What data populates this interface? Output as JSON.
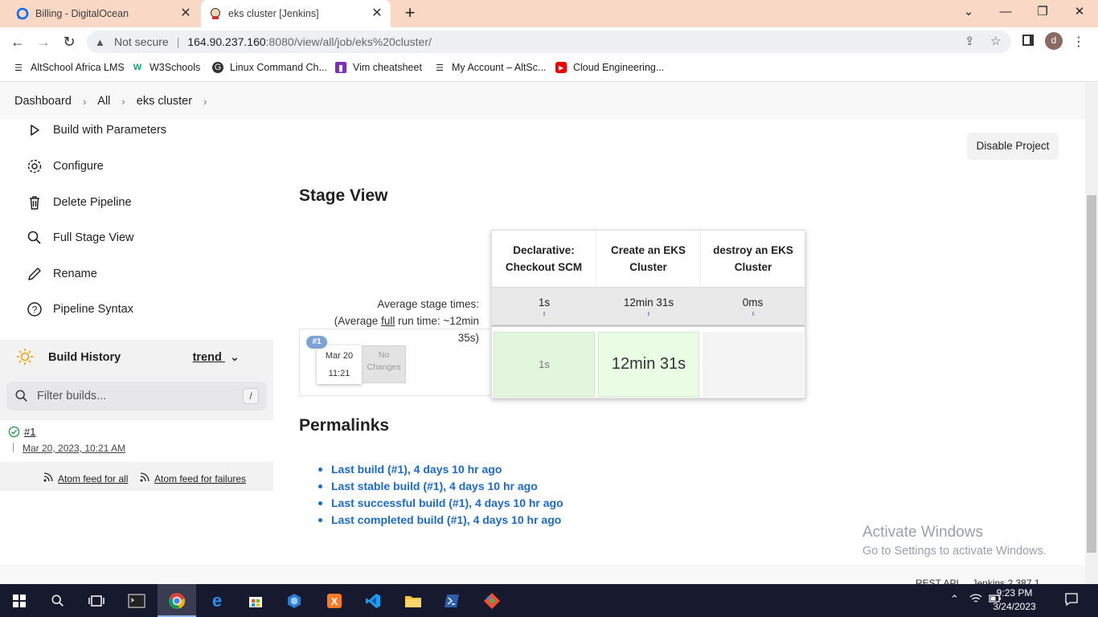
{
  "browser": {
    "tabs": [
      {
        "title": "Billing - DigitalOcean",
        "icon": "digitalocean-icon"
      },
      {
        "title": "eks cluster [Jenkins]",
        "icon": "jenkins-icon",
        "active": true
      }
    ],
    "address": {
      "security": "Not secure",
      "host": "164.90.237.160",
      "path": ":8080/view/all/job/eks%20cluster/"
    },
    "profile_initial": "d",
    "bookmarks": [
      {
        "label": "AltSchool Africa LMS",
        "icon": "folder-icon"
      },
      {
        "label": "W3Schools",
        "icon": "w3schools-icon"
      },
      {
        "label": "Linux Command Ch...",
        "icon": "linux-icon"
      },
      {
        "label": "Vim cheatsheet",
        "icon": "vim-icon"
      },
      {
        "label": "My Account – AltSc...",
        "icon": "folder-icon"
      },
      {
        "label": "Cloud Engineering...",
        "icon": "youtube-icon"
      }
    ]
  },
  "breadcrumb": [
    "Dashboard",
    "All",
    "eks cluster"
  ],
  "sidebar": {
    "tasks": [
      {
        "label": "Build with Parameters",
        "icon": "play-icon"
      },
      {
        "label": "Configure",
        "icon": "gear-icon"
      },
      {
        "label": "Delete Pipeline",
        "icon": "trash-icon"
      },
      {
        "label": "Full Stage View",
        "icon": "search-icon"
      },
      {
        "label": "Rename",
        "icon": "pencil-icon"
      },
      {
        "label": "Pipeline Syntax",
        "icon": "help-icon"
      }
    ],
    "build_history": {
      "title": "Build History",
      "trend": "trend",
      "filter_placeholder": "Filter builds...",
      "shortcut": "/",
      "builds": [
        {
          "number": "#1",
          "date": "Mar 20, 2023, 10:21 AM",
          "status": "success"
        }
      ],
      "feeds": [
        "Atom feed for all",
        "Atom feed for failures"
      ]
    }
  },
  "main": {
    "disable_button": "Disable Project",
    "stage_view_title": "Stage View",
    "avg_label": "Average stage times:",
    "avg_full_1": "(Average ",
    "avg_full_word": "full",
    "avg_full_2": " run time: ~12min",
    "avg_full_3": "35s)",
    "run": {
      "badge": "#1",
      "date": "Mar 20",
      "time": "11:21",
      "changes_1": "No",
      "changes_2": "Changes"
    },
    "stages": [
      {
        "name": "Declarative: Checkout SCM",
        "avg": "1s",
        "value": "1s",
        "status": "success"
      },
      {
        "name": "Create an EKS Cluster",
        "avg": "12min 31s",
        "value": "12min 31s",
        "status": "success"
      },
      {
        "name": "destroy an EKS Cluster",
        "avg": "0ms",
        "value": "",
        "status": "none"
      }
    ],
    "permalinks_title": "Permalinks",
    "permalinks": [
      "Last build (#1), 4 days 10 hr ago",
      "Last stable build (#1), 4 days 10 hr ago",
      "Last successful build (#1), 4 days 10 hr ago",
      "Last completed build (#1), 4 days 10 hr ago"
    ],
    "footer_partial": "REST API     Jenkins 2.387.1"
  },
  "watermark": {
    "line1": "Activate Windows",
    "line2": "Go to Settings to activate Windows."
  },
  "taskbar": {
    "time": "9:23 PM",
    "date": "3/24/2023"
  },
  "colors": {
    "success_cell": "#e2f6dd",
    "success_cell_strong": "#e9fde4",
    "link": "#1a6bcc",
    "tabbar": "#f9d8c5"
  }
}
